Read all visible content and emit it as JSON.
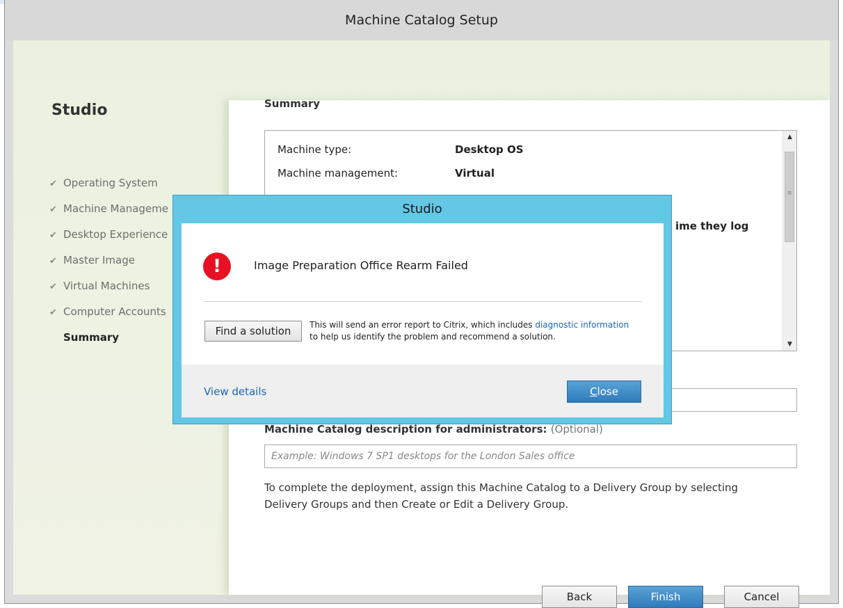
{
  "window": {
    "title": "Machine Catalog Setup"
  },
  "sidebar": {
    "title": "Studio",
    "steps": [
      {
        "label": "Operating System",
        "completed": true
      },
      {
        "label": "Machine Manageme",
        "completed": true
      },
      {
        "label": "Desktop Experience",
        "completed": true
      },
      {
        "label": "Master Image",
        "completed": true
      },
      {
        "label": "Virtual Machines",
        "completed": true
      },
      {
        "label": "Computer Accounts",
        "completed": true
      },
      {
        "label": "Summary",
        "completed": false,
        "current": true
      }
    ]
  },
  "summary": {
    "heading": "Summary",
    "rows": [
      {
        "key": "Machine type:",
        "value": "Desktop OS"
      },
      {
        "key": "Machine management:",
        "value": "Virtual"
      }
    ],
    "partial_text": "ime they log"
  },
  "form": {
    "description_label": "Machine Catalog description for administrators:",
    "description_optional": "(Optional)",
    "description_placeholder": "Example: Windows 7 SP1 desktops for the London Sales office",
    "help_text": "To complete the deployment, assign this Machine Catalog to a Delivery Group by selecting Delivery Groups and then Create or Edit a Delivery Group."
  },
  "buttons": {
    "back": "Back",
    "finish": "Finish",
    "cancel": "Cancel"
  },
  "dialog": {
    "title": "Studio",
    "message": "Image Preparation Office Rearm Failed",
    "find_solution": "Find a solution",
    "report_line1": "This will send an error report to Citrix, which includes",
    "report_link": "diagnostic information",
    "report_line2": "to help us identify the problem and recommend a solution.",
    "view_details": "View details",
    "close_underlined": "C",
    "close_rest": "lose"
  },
  "colors": {
    "dialog_frame": "#63c7e6",
    "error_icon": "#e81123",
    "primary_button": "#2f7bbc",
    "link": "#1a67b8",
    "wizard_background": "#ebf1df"
  },
  "icons": {
    "check": "check-icon",
    "error": "error-icon",
    "scroll_up": "scroll-up-icon",
    "scroll_down": "scroll-down-icon"
  }
}
